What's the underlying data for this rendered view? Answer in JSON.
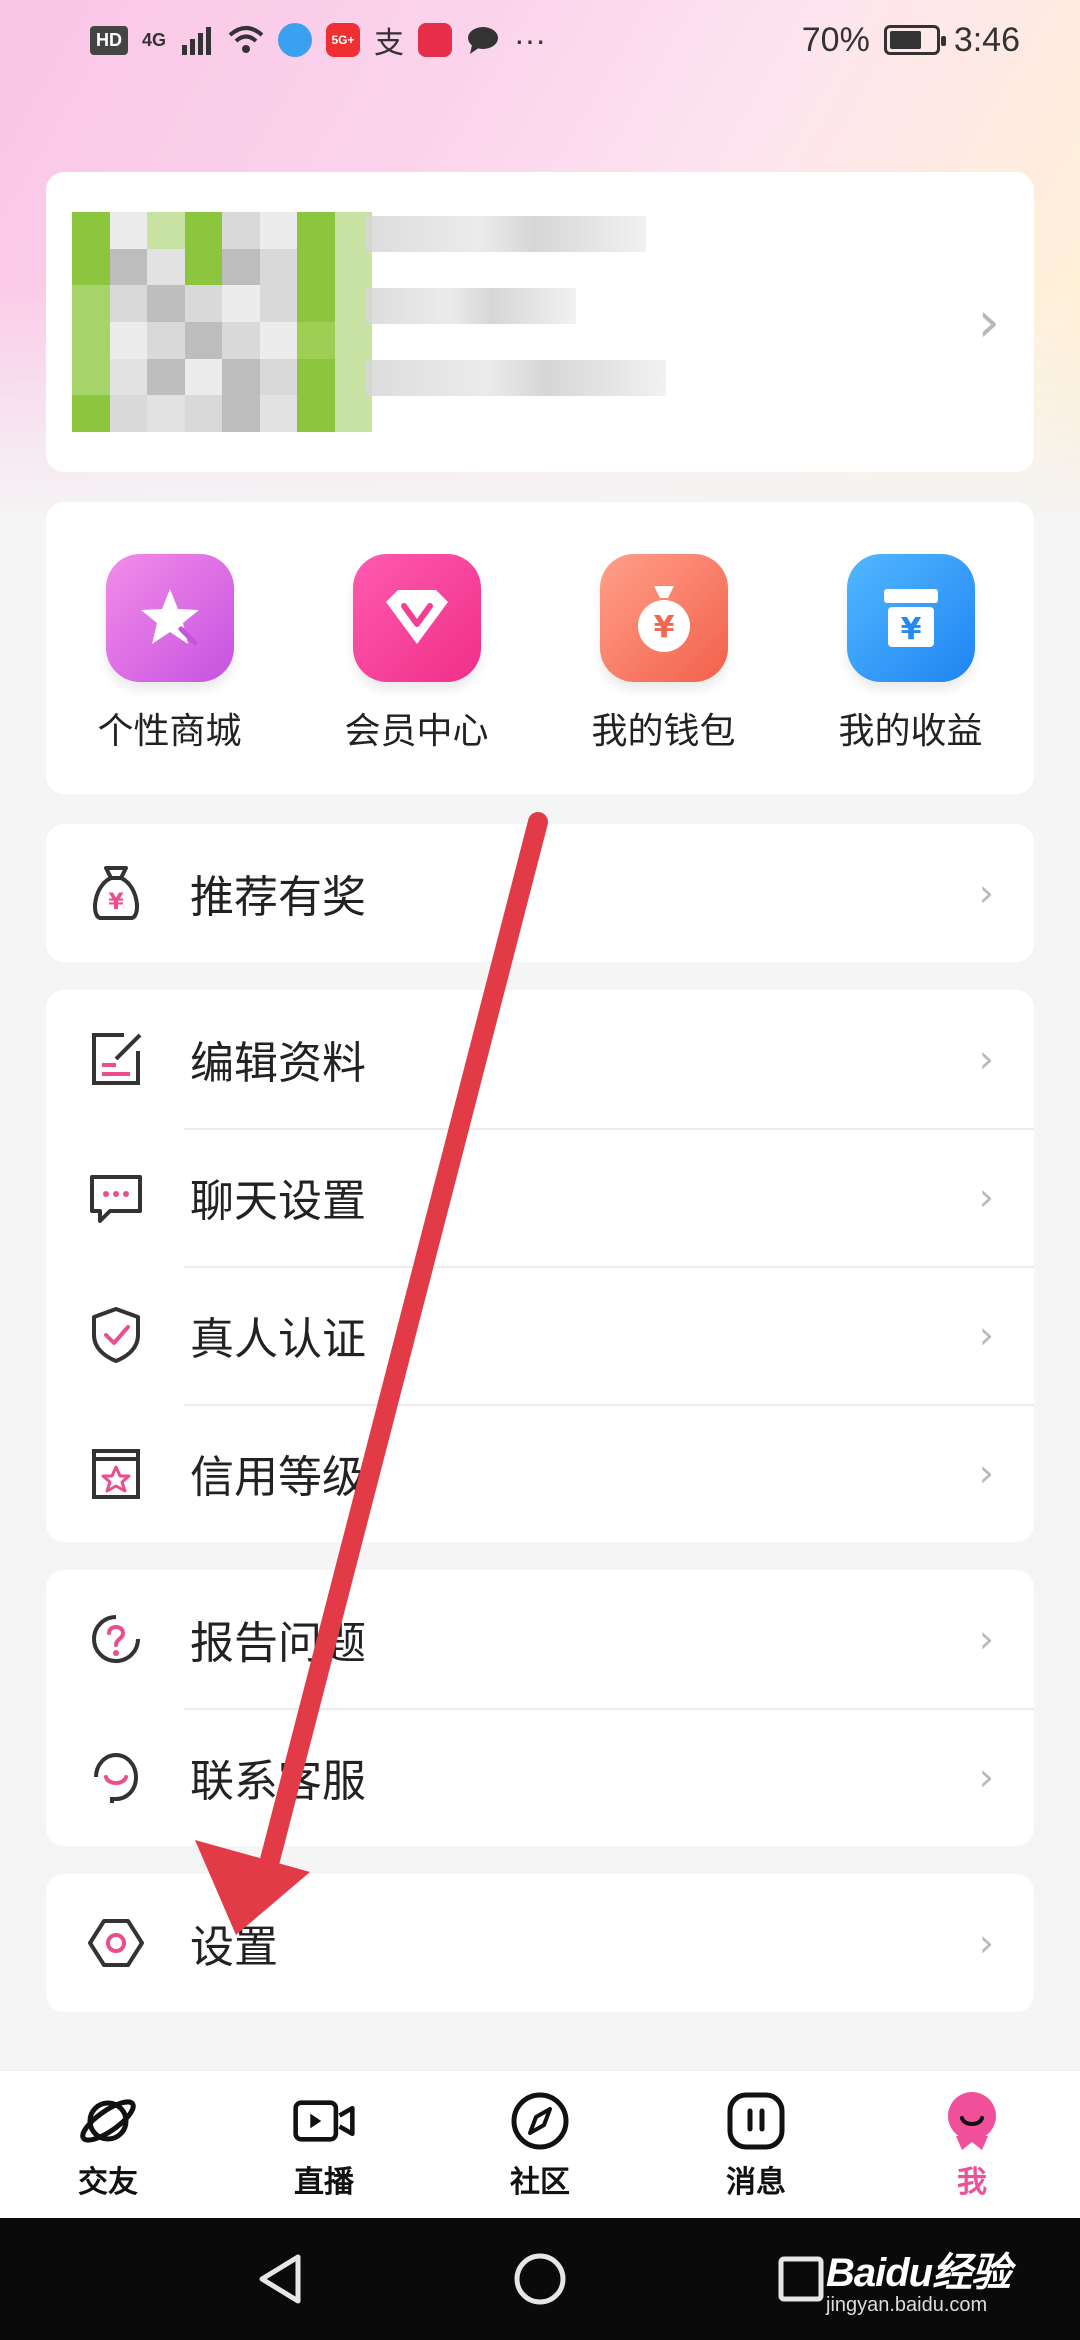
{
  "status_bar": {
    "hd_label": "HD",
    "network": "4G",
    "app_badge": "5G+",
    "alipay_char": "支",
    "more": "···",
    "battery_text": "70%",
    "battery_level": 0.7,
    "time": "3:46"
  },
  "profile": {
    "chevron": "›"
  },
  "quick_actions": [
    {
      "label": "个性商城",
      "icon": "star-wand-icon",
      "color": "#d66ae6"
    },
    {
      "label": "会员中心",
      "icon": "diamond-v-icon",
      "color": "#f53d95"
    },
    {
      "label": "我的钱包",
      "icon": "money-bag-icon",
      "color": "#f6735a"
    },
    {
      "label": "我的收益",
      "icon": "yuan-box-icon",
      "color": "#2f93f7"
    }
  ],
  "groups": {
    "invite": [
      {
        "label": "推荐有奖",
        "icon": "money-bag-outline-icon"
      }
    ],
    "profile": [
      {
        "label": "编辑资料",
        "icon": "edit-note-icon"
      },
      {
        "label": "聊天设置",
        "icon": "chat-bubble-icon"
      },
      {
        "label": "真人认证",
        "icon": "shield-check-icon"
      },
      {
        "label": "信用等级",
        "icon": "star-badge-icon"
      }
    ],
    "help": [
      {
        "label": "报告问题",
        "icon": "question-icon"
      },
      {
        "label": "联系客服",
        "icon": "customer-service-icon"
      }
    ],
    "settings": [
      {
        "label": "设置",
        "icon": "hex-nut-icon"
      }
    ]
  },
  "row_chevron": "›",
  "bottom_nav": [
    {
      "label": "交友",
      "icon": "planet-icon",
      "active": false
    },
    {
      "label": "直播",
      "icon": "video-camera-icon",
      "active": false
    },
    {
      "label": "社区",
      "icon": "compass-icon",
      "active": false
    },
    {
      "label": "消息",
      "icon": "message-icon",
      "active": false
    },
    {
      "label": "我",
      "icon": "me-avatar-icon",
      "active": true
    }
  ],
  "colors": {
    "accent_pink": "#f0509a",
    "icon_pink": "#ec4d8c",
    "icon_dark": "#333333",
    "arrow_red": "#e23a47"
  },
  "watermark": {
    "brand": "Baidu经验",
    "url": "jingyan.baidu.com"
  }
}
